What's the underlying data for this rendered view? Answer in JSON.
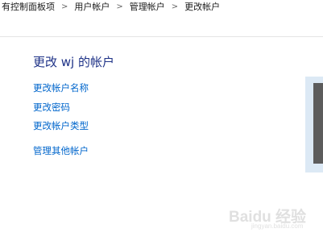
{
  "breadcrumb": {
    "items": [
      "有控制面板项",
      "用户帐户",
      "管理帐户",
      "更改帐户"
    ],
    "separator": ">"
  },
  "main": {
    "title": "更改 wj 的帐户",
    "links": [
      "更改帐户名称",
      "更改密码",
      "更改帐户类型",
      "管理其他帐户"
    ]
  },
  "watermark": {
    "brand": "Baidu 经验",
    "url": "jingyan.baidu.com"
  },
  "colors": {
    "title": "#1e3287",
    "link": "#0066cc",
    "panel": "#dce9f5"
  }
}
